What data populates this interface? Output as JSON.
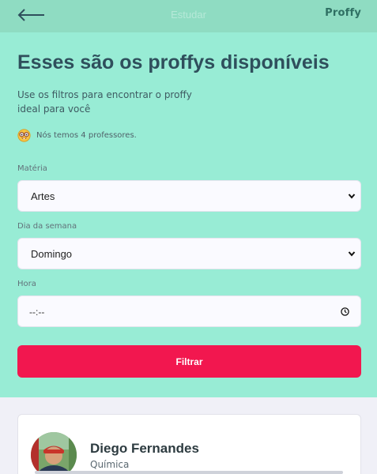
{
  "header": {
    "back_icon": "arrow-left-icon",
    "title": "Estudar",
    "logo": "Proffy"
  },
  "hero": {
    "title": "Esses são os proffys disponíveis",
    "description": "Use os filtros para encontrar o proffy ideal para você",
    "count_icon": "nerd-face-emoji-icon",
    "count_text": "Nós temos 4 professores."
  },
  "filters": {
    "subject": {
      "label": "Matéria",
      "value": "Artes"
    },
    "weekday": {
      "label": "Dia da semana",
      "value": "Domingo"
    },
    "time": {
      "label": "Hora",
      "value": "--:--"
    },
    "submit_label": "Filtrar"
  },
  "teachers": [
    {
      "name": "Diego Fernandes",
      "subject": "Química",
      "avatar_icon": "teacher-photo"
    }
  ],
  "colors": {
    "header_bg": "#8fdcc2",
    "hero_bg": "#98ecd5",
    "button": "#f2174f",
    "page_bg": "#f0f0f7"
  }
}
